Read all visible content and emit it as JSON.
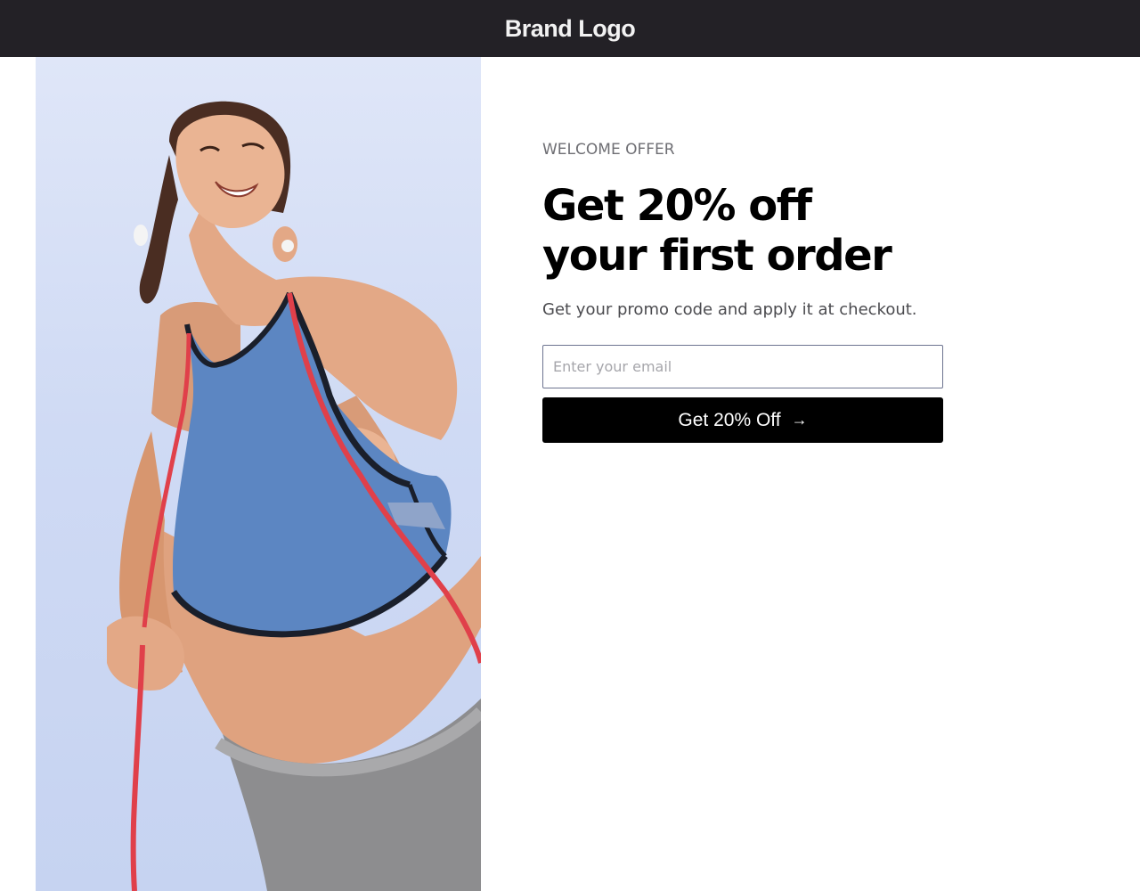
{
  "header": {
    "logo_text": "Brand Logo"
  },
  "hero": {
    "image_alt": "Smiling woman in a blue sports top holding a red jump rope against the sky"
  },
  "offer": {
    "eyebrow": "WELCOME OFFER",
    "headline_line1": "Get 20% off",
    "headline_line2": "your first order",
    "subtext": "Get your promo code and apply it at checkout.",
    "email_placeholder": "Enter your email",
    "email_value": "",
    "cta_label": "Get 20% Off",
    "cta_icon": "arrow-right-icon"
  },
  "colors": {
    "header_bg": "#232126",
    "cta_bg": "#000000",
    "cta_text": "#ffffff",
    "eyebrow": "#6e6e73"
  }
}
